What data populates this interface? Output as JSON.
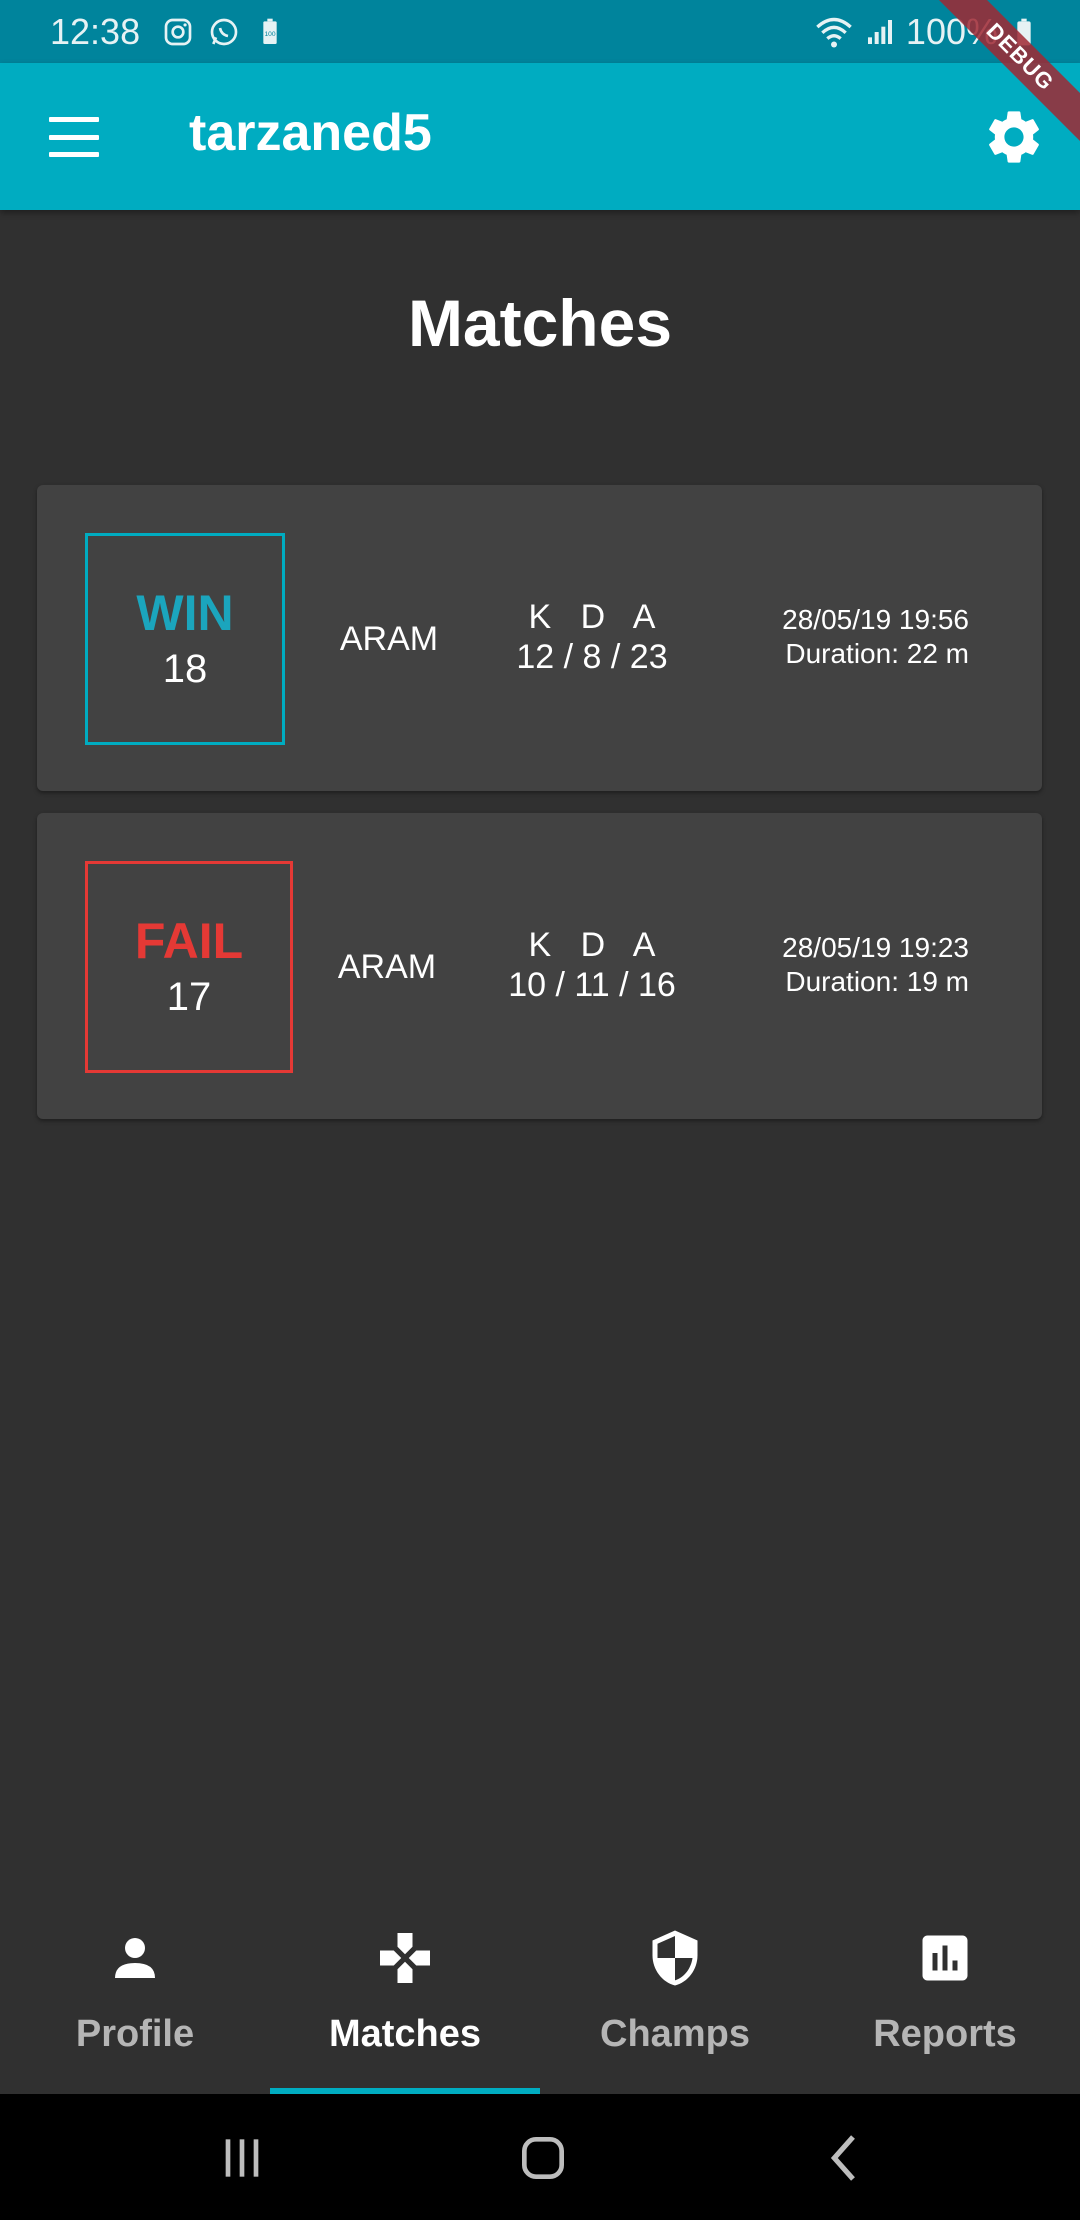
{
  "status_bar": {
    "time": "12:38",
    "battery": "100%",
    "icons": [
      "instagram-icon",
      "whatsapp-icon",
      "battery-saver-icon",
      "wifi-icon",
      "signal-icon",
      "battery-icon"
    ]
  },
  "debug_banner": "DEBUG",
  "app_bar": {
    "title": "tarzaned5",
    "menu_icon": "menu-icon",
    "settings_icon": "gear-icon"
  },
  "page": {
    "title": "Matches"
  },
  "matches": [
    {
      "result": "WIN",
      "level": "18",
      "mode": "ARAM",
      "kda_header": "K D A",
      "kda": "12 / 8 / 23",
      "date": "28/05/19 19:56",
      "duration": "Duration: 22 m"
    },
    {
      "result": "FAIL",
      "level": "17",
      "mode": "ARAM",
      "kda_header": "K D A",
      "kda": "10 / 11 / 16",
      "date": "28/05/19 19:23",
      "duration": "Duration: 19 m"
    }
  ],
  "bottom_nav": {
    "items": [
      {
        "label": "Profile",
        "icon": "person-icon"
      },
      {
        "label": "Matches",
        "icon": "gamepad-icon",
        "active": true
      },
      {
        "label": "Champs",
        "icon": "shield-icon"
      },
      {
        "label": "Reports",
        "icon": "bar-chart-icon"
      }
    ]
  },
  "colors": {
    "accent": "#00acc1",
    "status_bar": "#00849c",
    "background": "#303030",
    "card": "#424242",
    "win": "#1ba5bd",
    "fail": "#e53935"
  }
}
